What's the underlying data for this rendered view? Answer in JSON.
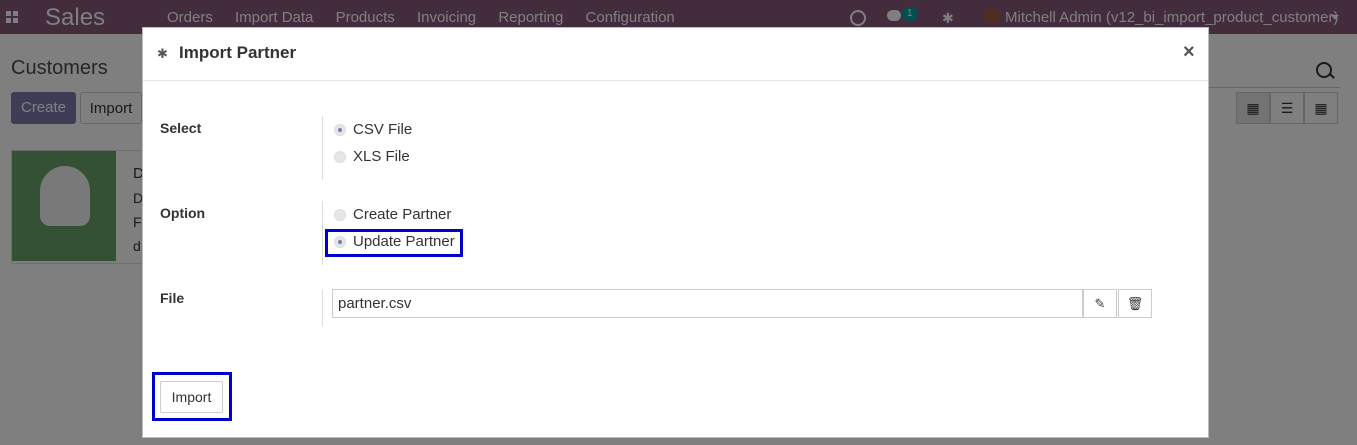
{
  "navbar": {
    "brand": "Sales",
    "menu": [
      "Orders",
      "Import Data",
      "Products",
      "Invoicing",
      "Reporting",
      "Configuration"
    ],
    "chat_badge": "1",
    "user": "Mitchell Admin (v12_bi_import_product_customer)"
  },
  "control_panel": {
    "title": "Customers",
    "create_label": "Create",
    "import_label": "Import"
  },
  "kanban": {
    "line1": "D",
    "line2": "D",
    "line3": "F",
    "line4": "d"
  },
  "modal": {
    "title": "Import Partner",
    "close_label": "×",
    "select_label": "Select",
    "select_options": [
      "CSV File",
      "XLS File"
    ],
    "selected_file_type": "CSV File",
    "option_label": "Option",
    "option_options": [
      "Create Partner",
      "Update Partner"
    ],
    "selected_option": "Update Partner",
    "file_label": "File",
    "file_value": "partner.csv",
    "import_button": "Import"
  },
  "colors": {
    "navbar": "#875a7b",
    "primary": "#7c7bad",
    "highlight": "#0000cc"
  }
}
